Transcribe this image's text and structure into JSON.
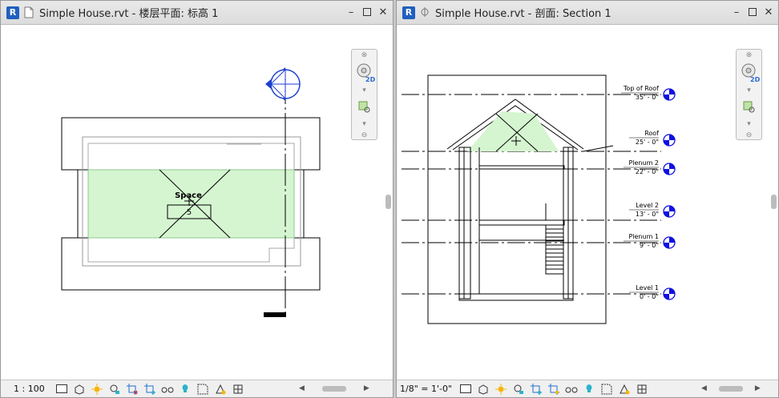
{
  "left_window": {
    "title": "Simple House.rvt - 楼层平面: 标高 1",
    "scale": "1 : 100",
    "space_label": "Space",
    "space_number": "5"
  },
  "right_window": {
    "title": "Simple House.rvt - 剖面: Section 1",
    "scale": "1/8\" = 1'-0\"",
    "levels": [
      {
        "name": "Top of Roof",
        "elevation": "35' - 0\""
      },
      {
        "name": "Roof",
        "elevation": "25' - 0\""
      },
      {
        "name": "Plenum 2",
        "elevation": "22' - 0\""
      },
      {
        "name": "Level 2",
        "elevation": "13' - 0\""
      },
      {
        "name": "Plenum 1",
        "elevation": "9' - 0\""
      },
      {
        "name": "Level 1",
        "elevation": "0' - 0\""
      }
    ]
  },
  "navbar": {
    "mode_2d": "2D"
  },
  "colors": {
    "space_fill": "#d5f5d0",
    "level_head": "#1010e0",
    "revit_blue": "#1f5fbf"
  },
  "icons": [
    "revit-logo-icon",
    "document-icon",
    "minimize-icon",
    "restore-icon",
    "close-icon",
    "steering-wheel-icon",
    "zoom-region-icon",
    "detail-level-icon",
    "visual-style-icon",
    "sun-path-icon",
    "shadows-icon",
    "crop-view-icon",
    "show-crop-icon",
    "temporary-hide-icon",
    "reveal-hidden-icon",
    "analytical-icon",
    "highlight-icon"
  ]
}
